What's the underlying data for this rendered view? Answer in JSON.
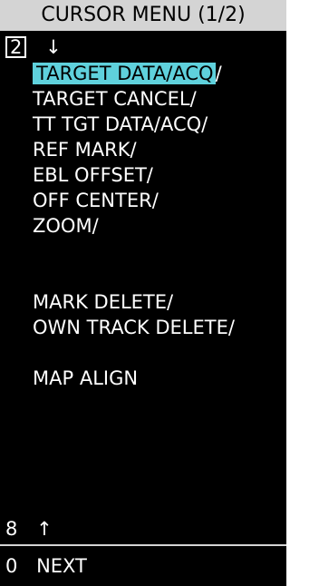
{
  "menu": {
    "title": "CURSOR MENU (1/2)",
    "page_number": "2",
    "up_arrow": "↓",
    "items": [
      {
        "label": "TARGET DATA/ACQ",
        "suffix": "/",
        "selected": true
      },
      {
        "label": "TARGET CANCEL/"
      },
      {
        "label": "TT TGT DATA/ACQ/"
      },
      {
        "label": "REF MARK/"
      },
      {
        "label": "EBL OFFSET/"
      },
      {
        "label": "OFF CENTER/"
      },
      {
        "label": "ZOOM/"
      },
      {
        "label": ""
      },
      {
        "label": ""
      },
      {
        "label": "MARK DELETE/"
      },
      {
        "label": "OWN TRACK DELETE/"
      },
      {
        "label": ""
      },
      {
        "label": "MAP ALIGN"
      }
    ],
    "scroll_down": {
      "key": "8",
      "arrow": "↑"
    },
    "next": {
      "key": "0",
      "label": "NEXT"
    }
  },
  "colors": {
    "background": "#000000",
    "title_bar": "#d4d4d4",
    "selection": "#5fd1dc",
    "text": "#ffffff"
  }
}
